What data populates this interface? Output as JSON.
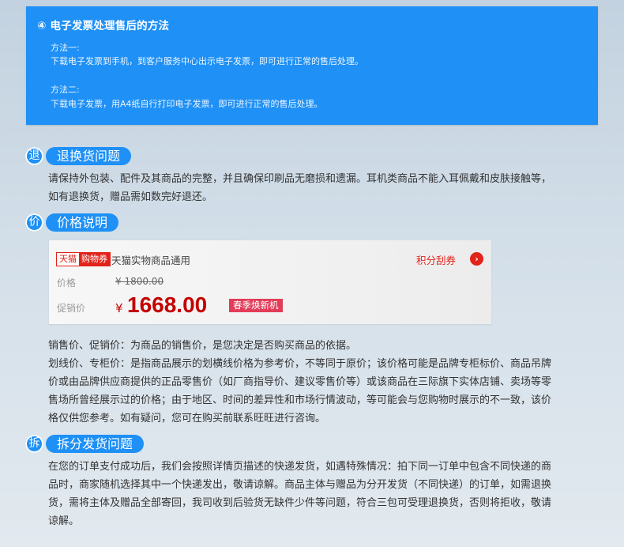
{
  "e_invoice": {
    "title": "④ 电子发票处理售后的方法",
    "method1_label": "方法一:",
    "method1_text": "下载电子发票到手机，到客户服务中心出示电子发票，即可进行正常的售后处理。",
    "method2_label": "方法二:",
    "method2_text": "下载电子发票，用A4纸自行打印电子发票，即可进行正常的售后处理。"
  },
  "returns": {
    "icon_char": "退",
    "title": "退换货问题",
    "lines": [
      "请保持外包装、配件及其商品的完整，并且确保印刷品无磨损和遗漏。耳机类商品不能入耳佩戴和皮肤接触等，",
      "如有退换货，赠品需如数完好退还。"
    ]
  },
  "price": {
    "icon_char": "价",
    "title": "价格说明",
    "card": {
      "badge_left": "天猫",
      "badge_right": "购物券",
      "tmall_text": "天猫实物商品通用",
      "points_label": "积分刮券",
      "arrow": "›",
      "orig_label": "价格",
      "orig_price": "¥ 1800.00",
      "promo_label": "促销价",
      "promo_yen": "¥",
      "promo_price": "1668.00",
      "promo_tag": "春季焕新机"
    },
    "lines": [
      "销售价、促销价：为商品的销售价，是您决定是否购买商品的依据。",
      "划线价、专柜价：是指商品展示的划横线价格为参考价，不等同于原价；该价格可能是品牌专柜标价、商品吊牌",
      "价或由品牌供应商提供的正品零售价（如厂商指导价、建议零售价等）或该商品在三际旗下实体店铺、卖场等零",
      "售场所曾经展示过的价格；由于地区、时间的差异性和市场行情波动，等可能会与您购物时展示的不一致，该价",
      "格仅供您参考。如有疑问，您可在购买前联系旺旺进行咨询。"
    ]
  },
  "split": {
    "icon_char": "拆",
    "title": "拆分发货问题",
    "lines": [
      "在您的订单支付成功后，我们会按照详情页描述的快递发货，如遇特殊情况：拍下同一订单中包含不同快递的商",
      "品时，商家随机选择其中一个快递发出，敬请谅解。商品主体与赠品为分开发货（不同快递）的订单，如需退换",
      "货，需将主体及赠品全部寄回，我司收到后验货无缺件少件等问题，符合三包可受理退换货，否则将拒收，敬请",
      "谅解。"
    ]
  }
}
